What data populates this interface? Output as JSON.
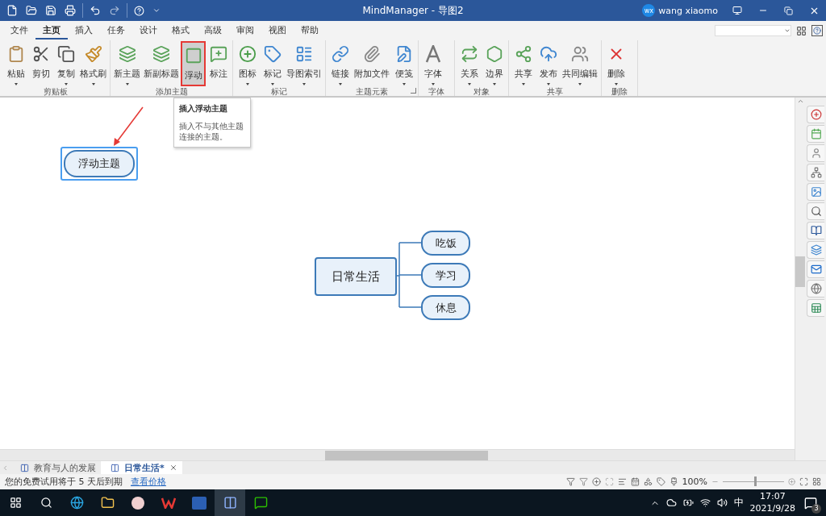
{
  "window": {
    "title": "MindManager - 导图2",
    "user": {
      "initials": "wx",
      "name": "wang xiaomo"
    }
  },
  "menu_tabs": [
    {
      "label": "文件",
      "selected": false
    },
    {
      "label": "主页",
      "selected": true
    },
    {
      "label": "插入",
      "selected": false
    },
    {
      "label": "任务",
      "selected": false
    },
    {
      "label": "设计",
      "selected": false
    },
    {
      "label": "格式",
      "selected": false
    },
    {
      "label": "高级",
      "selected": false
    },
    {
      "label": "审阅",
      "selected": false
    },
    {
      "label": "视图",
      "selected": false
    },
    {
      "label": "帮助",
      "selected": false
    }
  ],
  "ribbon": {
    "groups": [
      {
        "label": "剪贴板",
        "launcher": false,
        "items": [
          {
            "label": "粘贴",
            "dropdown": true,
            "selected": false
          },
          {
            "label": "剪切",
            "dropdown": false,
            "selected": false
          },
          {
            "label": "复制",
            "dropdown": true,
            "selected": false
          },
          {
            "label": "格式刷",
            "dropdown": true,
            "selected": false
          }
        ]
      },
      {
        "label": "添加主题",
        "launcher": false,
        "items": [
          {
            "label": "新主题",
            "dropdown": true,
            "selected": false
          },
          {
            "label": "新副标题",
            "dropdown": false,
            "selected": false
          },
          {
            "label": "浮动",
            "dropdown": false,
            "selected": true
          },
          {
            "label": "标注",
            "dropdown": false,
            "selected": false
          }
        ]
      },
      {
        "label": "标记",
        "launcher": false,
        "items": [
          {
            "label": "图标",
            "dropdown": true,
            "selected": false
          },
          {
            "label": "标记",
            "dropdown": true,
            "selected": false
          },
          {
            "label": "导图索引",
            "dropdown": true,
            "selected": false
          }
        ]
      },
      {
        "label": "主题元素",
        "launcher": true,
        "items": [
          {
            "label": "链接",
            "dropdown": true,
            "selected": false
          },
          {
            "label": "附加文件",
            "dropdown": false,
            "selected": false
          },
          {
            "label": "便笺",
            "dropdown": true,
            "selected": false
          }
        ]
      },
      {
        "label": "字体",
        "launcher": false,
        "items": [
          {
            "label": "字体",
            "dropdown": true,
            "selected": false
          }
        ]
      },
      {
        "label": "对象",
        "launcher": false,
        "items": [
          {
            "label": "关系",
            "dropdown": true,
            "selected": false
          },
          {
            "label": "边界",
            "dropdown": true,
            "selected": false
          }
        ]
      },
      {
        "label": "共享",
        "launcher": false,
        "items": [
          {
            "label": "共享",
            "dropdown": true,
            "selected": false
          },
          {
            "label": "发布",
            "dropdown": true,
            "selected": false
          },
          {
            "label": "共同编辑",
            "dropdown": true,
            "selected": false
          }
        ]
      },
      {
        "label": "删除",
        "launcher": false,
        "items": [
          {
            "label": "删除",
            "dropdown": true,
            "selected": false
          }
        ]
      }
    ]
  },
  "tooltip": {
    "title": "插入浮动主题",
    "text": "插入不与其他主题连接的主题。"
  },
  "map": {
    "floating_topic": {
      "text": "浮动主题",
      "selected": true
    },
    "central_topic": {
      "text": "日常生活",
      "children": [
        {
          "text": "吃饭"
        },
        {
          "text": "学习"
        },
        {
          "text": "休息"
        }
      ]
    }
  },
  "document_tabs": [
    {
      "label": "教育与人的发展",
      "selected": false
    },
    {
      "label": "日常生活*",
      "selected": true
    }
  ],
  "status_bar": {
    "message": "您的免费试用将于 5 天后到期",
    "link": "查看价格",
    "zoom": "100%",
    "zoom_slider": {
      "level": 0.52
    }
  },
  "taskbar": {
    "input_method": "中",
    "time": "17:07",
    "date": "2021/9/28",
    "notifications": "3"
  }
}
